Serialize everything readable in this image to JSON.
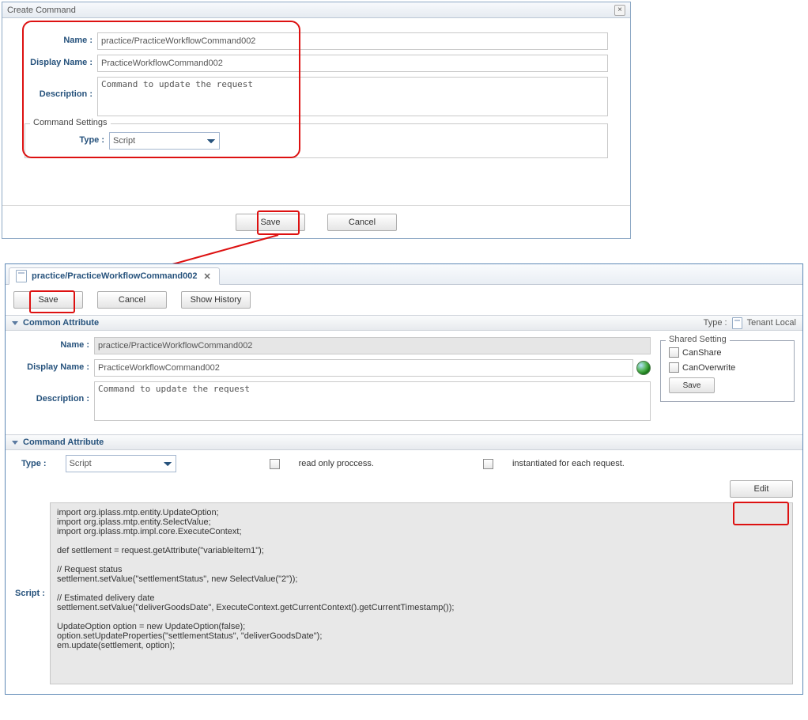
{
  "dialog1": {
    "title": "Create Command",
    "labels": {
      "name": "Name :",
      "displayName": "Display Name :",
      "description": "Description :",
      "type": "Type :"
    },
    "fields": {
      "name": "practice/PracticeWorkflowCommand002",
      "displayName": "PracticeWorkflowCommand002",
      "description": "Command to update the request",
      "type": "Script"
    },
    "fieldset_title": "Command Settings",
    "save": "Save",
    "cancel": "Cancel"
  },
  "panel2": {
    "tab_label": "practice/PracticeWorkflowCommand002",
    "toolbar": {
      "save": "Save",
      "cancel": "Cancel",
      "show_history": "Show History"
    },
    "section_common": "Common Attribute",
    "section_command": "Command Attribute",
    "type_label": "Type :",
    "type_value": "Tenant Local",
    "labels": {
      "name": "Name :",
      "displayName": "Display Name :",
      "description": "Description :",
      "type": "Type :",
      "script": "Script :"
    },
    "fields": {
      "name": "practice/PracticeWorkflowCommand002",
      "displayName": "PracticeWorkflowCommand002",
      "description": "Command to update the request",
      "type": "Script"
    },
    "checks": {
      "read_only": "read only proccess.",
      "inst_each": "instantiated for each request."
    },
    "shared": {
      "title": "Shared Setting",
      "canShare": "CanShare",
      "canOverwrite": "CanOverwrite",
      "save": "Save"
    },
    "edit": "Edit",
    "script_code": "import org.iplass.mtp.entity.UpdateOption;\nimport org.iplass.mtp.entity.SelectValue;\nimport org.iplass.mtp.impl.core.ExecuteContext;\n\ndef settlement = request.getAttribute(\"variableItem1\");\n\n// Request status\nsettlement.setValue(\"settlementStatus\", new SelectValue(\"2\"));\n\n// Estimated delivery date\nsettlement.setValue(\"deliverGoodsDate\", ExecuteContext.getCurrentContext().getCurrentTimestamp());\n\nUpdateOption option = new UpdateOption(false);\noption.setUpdateProperties(\"settlementStatus\", \"deliverGoodsDate\");\nem.update(settlement, option);"
  }
}
